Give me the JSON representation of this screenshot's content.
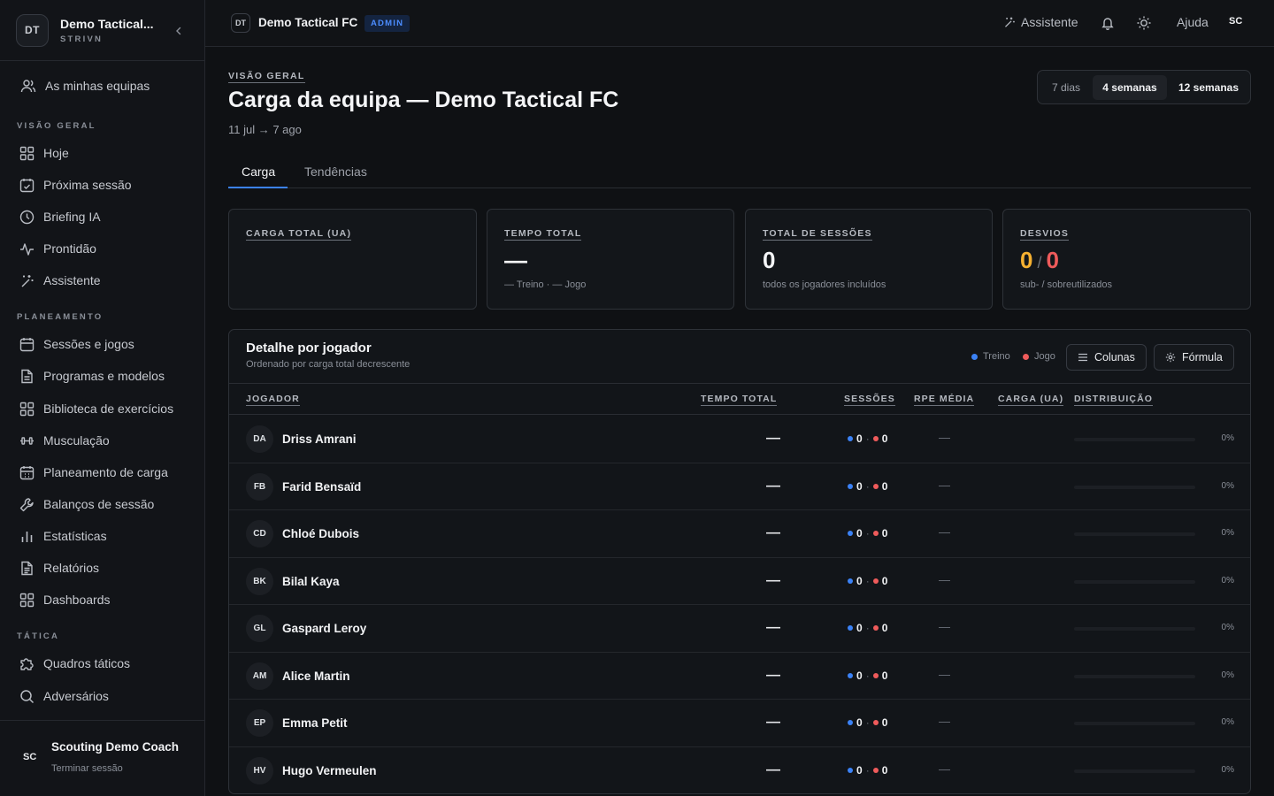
{
  "sidebar": {
    "logo_initials": "DT",
    "team_name": "Demo Tactical...",
    "brand": "STRIVN",
    "my_teams": "As minhas equipas",
    "sections": {
      "overview": "VISÃO GERAL",
      "planning": "PLANEAMENTO",
      "tactics": "TÁTICA"
    },
    "items": {
      "today": "Hoje",
      "next_session": "Próxima sessão",
      "ai_briefing": "Briefing IA",
      "readiness": "Prontidão",
      "assistant": "Assistente",
      "sessions_games": "Sessões e jogos",
      "programs_templates": "Programas e modelos",
      "exercise_library": "Biblioteca de exercícios",
      "strength": "Musculação",
      "load_planning": "Planeamento de carga",
      "session_reviews": "Balanços de sessão",
      "statistics": "Estatísticas",
      "reports": "Relatórios",
      "dashboards": "Dashboards",
      "tactical_boards": "Quadros táticos",
      "opponents": "Adversários"
    },
    "user": {
      "initials": "SC",
      "name": "Scouting Demo Coach",
      "logout": "Terminar sessão"
    }
  },
  "topbar": {
    "logo_initials": "DT",
    "team_name": "Demo Tactical FC",
    "badge": "ADMIN",
    "assistant": "Assistente",
    "help": "Ajuda",
    "user_initials": "SC"
  },
  "header": {
    "eyebrow": "VISÃO GERAL",
    "title": "Carga da equipa — Demo Tactical FC",
    "range": "11 jul → 7 ago",
    "periods": [
      "7 dias",
      "4 semanas",
      "12 semanas"
    ],
    "active_period": "4 semanas"
  },
  "tabs": [
    "Carga",
    "Tendências"
  ],
  "kpis": {
    "total_load": {
      "label": "CARGA TOTAL (UA)"
    },
    "total_time": {
      "label": "TEMPO TOTAL",
      "value": "—",
      "sub": "— Treino · — Jogo"
    },
    "total_sessions": {
      "label": "TOTAL DE SESSÕES",
      "value": "0",
      "sub": "todos os jogadores incluídos"
    },
    "deviations": {
      "label": "DESVIOS",
      "under": "0",
      "slash": "/",
      "over": "0",
      "sub": "sub- / sobreutilizados"
    }
  },
  "table": {
    "title": "Detalhe por jogador",
    "subtitle": "Ordenado por carga total decrescente",
    "legend": {
      "training": "Treino",
      "match": "Jogo"
    },
    "columns_button": "Colunas",
    "formula_button": "Fórmula",
    "headers": {
      "player": "JOGADOR",
      "total_time": "TEMPO TOTAL",
      "sessions": "SESSÕES",
      "rpe": "RPE MÉDIA",
      "load": "CARGA (UA)",
      "distribution": "DISTRIBUIÇÃO"
    },
    "rows": [
      {
        "initials": "DA",
        "name": "Driss Amrani",
        "time": "—",
        "training": "0",
        "match": "0",
        "rpe": "—",
        "pct": "0%",
        "fill": 0
      },
      {
        "initials": "FB",
        "name": "Farid Bensaïd",
        "time": "—",
        "training": "0",
        "match": "0",
        "rpe": "—",
        "pct": "0%",
        "fill": 0
      },
      {
        "initials": "CD",
        "name": "Chloé Dubois",
        "time": "—",
        "training": "0",
        "match": "0",
        "rpe": "—",
        "pct": "0%",
        "fill": 0
      },
      {
        "initials": "BK",
        "name": "Bilal Kaya",
        "time": "—",
        "training": "0",
        "match": "0",
        "rpe": "—",
        "pct": "0%",
        "fill": 0
      },
      {
        "initials": "GL",
        "name": "Gaspard Leroy",
        "time": "—",
        "training": "0",
        "match": "0",
        "rpe": "—",
        "pct": "0%",
        "fill": 0
      },
      {
        "initials": "AM",
        "name": "Alice Martin",
        "time": "—",
        "training": "0",
        "match": "0",
        "rpe": "—",
        "pct": "0%",
        "fill": 0
      },
      {
        "initials": "EP",
        "name": "Emma Petit",
        "time": "—",
        "training": "0",
        "match": "0",
        "rpe": "—",
        "pct": "0%",
        "fill": 0
      },
      {
        "initials": "HV",
        "name": "Hugo Vermeulen",
        "time": "—",
        "training": "0",
        "match": "0",
        "rpe": "—",
        "pct": "0%",
        "fill": 0
      }
    ]
  },
  "colors": {
    "accent": "#3b82f6",
    "training": "#3b82f6",
    "match": "#ef5b5b",
    "under": "#f5b031",
    "over": "#ef5b5b"
  },
  "icons": {
    "collapse": "chevron-left-icon",
    "my_teams": "users-icon",
    "today": "grid-icon",
    "next_session": "calendar-check-icon",
    "ai_briefing": "clock-icon",
    "readiness": "activity-icon",
    "assistant": "sparkles-icon",
    "sessions_games": "calendar-icon",
    "programs_templates": "file-icon",
    "exercise_library": "grid-icon",
    "strength": "dumbbell-icon",
    "load_planning": "calendar-grid-icon",
    "session_reviews": "wrench-icon",
    "statistics": "bar-chart-icon",
    "reports": "file-text-icon",
    "dashboards": "grid-icon",
    "tactical_boards": "puzzle-icon",
    "opponents": "search-icon",
    "bell": "bell-icon",
    "theme": "sun-icon",
    "columns": "menu-icon",
    "formula": "gear-icon"
  }
}
